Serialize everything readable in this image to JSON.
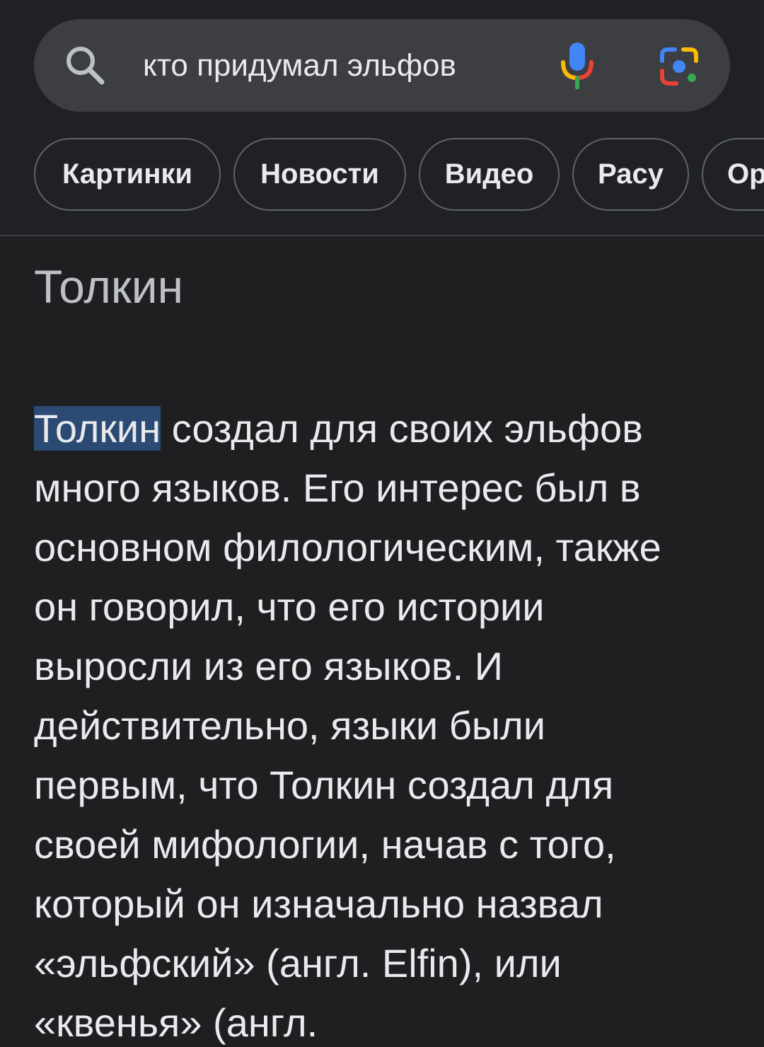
{
  "search": {
    "query": "кто придумал эльфов",
    "icons": {
      "search": "search-icon",
      "voice": "microphone-icon",
      "lens": "google-lens-icon"
    }
  },
  "chips": [
    {
      "label": "Картинки"
    },
    {
      "label": "Новости"
    },
    {
      "label": "Видео"
    },
    {
      "label": "Расу"
    },
    {
      "label": "Ор"
    }
  ],
  "result": {
    "title": "Толкин",
    "highlight_word": "Толкин",
    "first_line_rest": " создал для своих эльфов",
    "lines": [
      "много языков. Его интерес был в",
      "основном филологическим, также",
      "он говорил, что его истории",
      "выросли из его языков. И",
      "действительно, языки были",
      "первым, что Толкин создал для",
      "своей мифологии, начав с того,",
      "который он изначально назвал",
      "«эльфский» (англ. Elfin), или",
      "«квенья» (англ."
    ]
  },
  "colors": {
    "background": "#1f1f21",
    "search_bar": "#3c3e42",
    "chip_border": "#5f6368",
    "text": "#e8eaed",
    "title": "#bdc1c6",
    "highlight": "#2b4a74",
    "google_blue": "#4285f4",
    "google_red": "#ea4335",
    "google_yellow": "#fbbc04",
    "google_green": "#34a853"
  }
}
